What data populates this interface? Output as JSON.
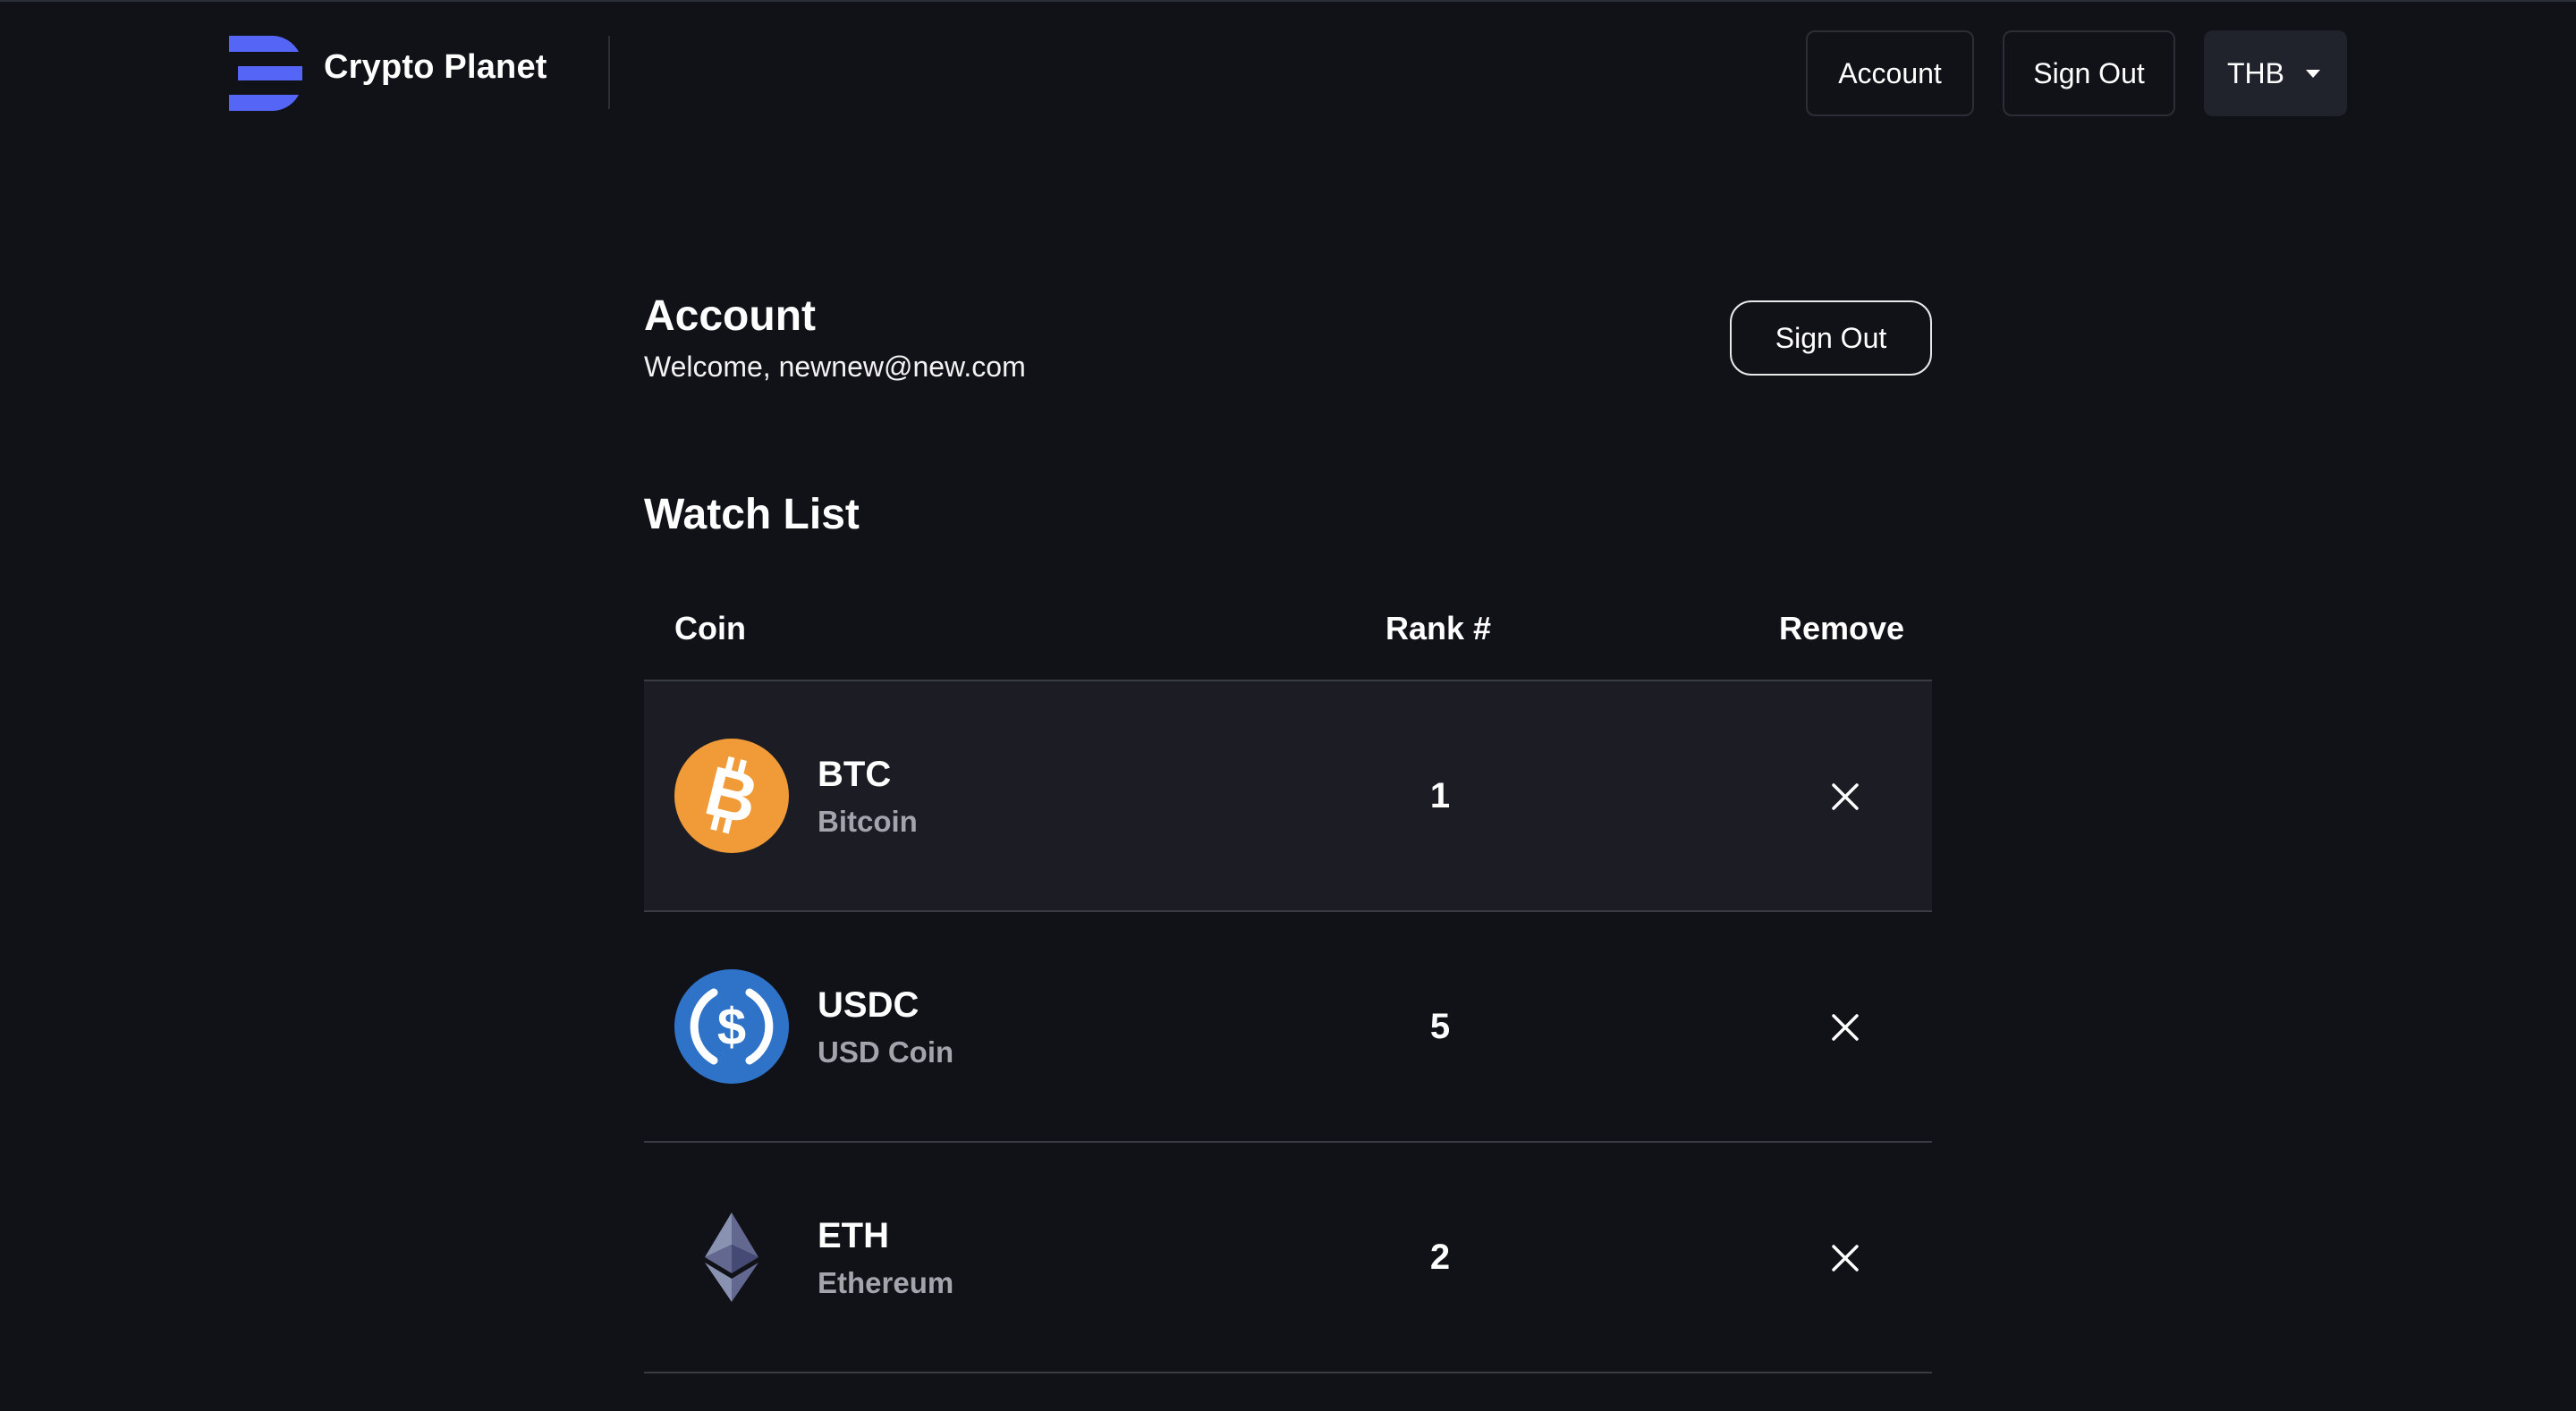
{
  "header": {
    "brand": "Crypto Planet",
    "account_label": "Account",
    "signout_label": "Sign Out",
    "currency": "THB",
    "logo_color": "#5565f6"
  },
  "account": {
    "title": "Account",
    "welcome": "Welcome, newnew@new.com",
    "signout_label": "Sign Out"
  },
  "watchlist": {
    "title": "Watch List",
    "columns": {
      "coin": "Coin",
      "rank": "Rank #",
      "remove": "Remove"
    },
    "rows": [
      {
        "symbol": "BTC",
        "name": "Bitcoin",
        "rank": "1",
        "icon": "bitcoin-icon",
        "color": "#f09a38"
      },
      {
        "symbol": "USDC",
        "name": "USD Coin",
        "rank": "5",
        "icon": "usdc-icon",
        "color": "#2f73c9"
      },
      {
        "symbol": "ETH",
        "name": "Ethereum",
        "rank": "2",
        "icon": "ethereum-icon",
        "color": "#8a92b2"
      }
    ]
  }
}
